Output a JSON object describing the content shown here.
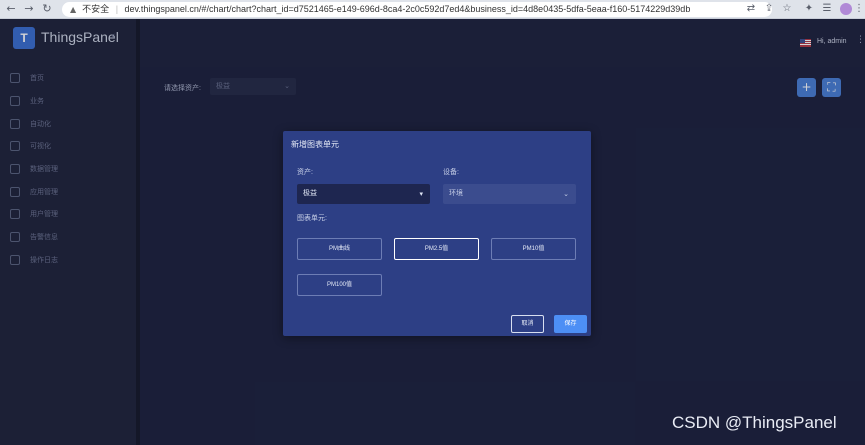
{
  "browser": {
    "security_label": "不安全",
    "url": "dev.thingspanel.cn/#/chart/chart?chart_id=d7521465-e149-696d-8ca4-2c0c592d7ed4&business_id=4d8e0435-5dfa-5eaa-f160-5174229d39db",
    "nav_icons": [
      "back-arrow",
      "forward-arrow",
      "reload"
    ]
  },
  "app": {
    "brand": "ThingsPanel",
    "collapse_icon": "chevron-left"
  },
  "sidebar": {
    "items": [
      {
        "label": "首页",
        "icon": "home-icon"
      },
      {
        "label": "业务",
        "icon": "rocket-icon"
      },
      {
        "label": "自动化",
        "icon": "automation-icon"
      },
      {
        "label": "可视化",
        "icon": "chart-icon"
      },
      {
        "label": "数据管理",
        "icon": "database-icon"
      },
      {
        "label": "应用管理",
        "icon": "basket-icon"
      },
      {
        "label": "用户管理",
        "icon": "user-icon"
      },
      {
        "label": "告警信息",
        "icon": "alert-icon"
      },
      {
        "label": "操作日志",
        "icon": "log-icon"
      }
    ]
  },
  "header": {
    "greeting": "Hi, admin"
  },
  "filter": {
    "label": "请选择资产:",
    "value": "极益"
  },
  "dialog": {
    "title": "新增图表单元",
    "asset_label": "资产:",
    "asset_value": "极益",
    "device_label": "设备:",
    "device_value": "环境",
    "units_label": "图表单元:",
    "units": [
      "PM曲线",
      "PM2.5值",
      "PM10值",
      "PM100值"
    ],
    "selected_unit": "PM2.5值",
    "cancel_label": "取消",
    "save_label": "保存"
  },
  "watermark": "CSDN @ThingsPanel",
  "colors": {
    "accent": "#4d8ff5",
    "dialog_bg": "#2d3f85",
    "page_bg": "#1e2340"
  }
}
